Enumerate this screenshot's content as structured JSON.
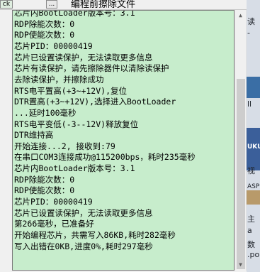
{
  "top": {
    "left_button": "ck",
    "dots_button": "...",
    "hint_text": "编程前擦除文件"
  },
  "log_lines": [
    "芯片内BootLoader版本号：3.1",
    "RDP除能次数：0",
    "RDP使能次数：0",
    "芯片PID：00000419",
    "芯片已设置读保护，无法读取更多信息",
    "芯片有读保护，请先擦除器件以清除读保护",
    "去除读保护，并擦除成功",
    "RTS电平置高(+3~+12V),复位",
    "DTR置高(+3~+12V),选择进入BootLoader",
    "...延时100毫秒",
    "RTS电平变低(-3--12V)释放复位",
    "DTR维持高",
    "开始连接...2, 接收到:79",
    "在串口COM3连接成功@115200bps，耗时235毫秒",
    "芯片内BootLoader版本号：3.1",
    "RDP除能次数：0",
    "RDP使能次数：0",
    "芯片PID：00000419",
    "芯片已设置读保护，无法读取更多信息",
    "第266毫秒，已准备好",
    "开始编程芯片，共需写入86KB,耗时282毫秒",
    "写入出错在0KB,进度0%,耗时297毫秒"
  ],
  "right_edge": {
    "labels": [
      "读",
      "-",
      "ll",
      "UKU",
      "视",
      "ASP",
      "主",
      "a",
      "数",
      ".po"
    ]
  },
  "colors": {
    "log_background": "#c7edcc",
    "text": "#000000"
  }
}
